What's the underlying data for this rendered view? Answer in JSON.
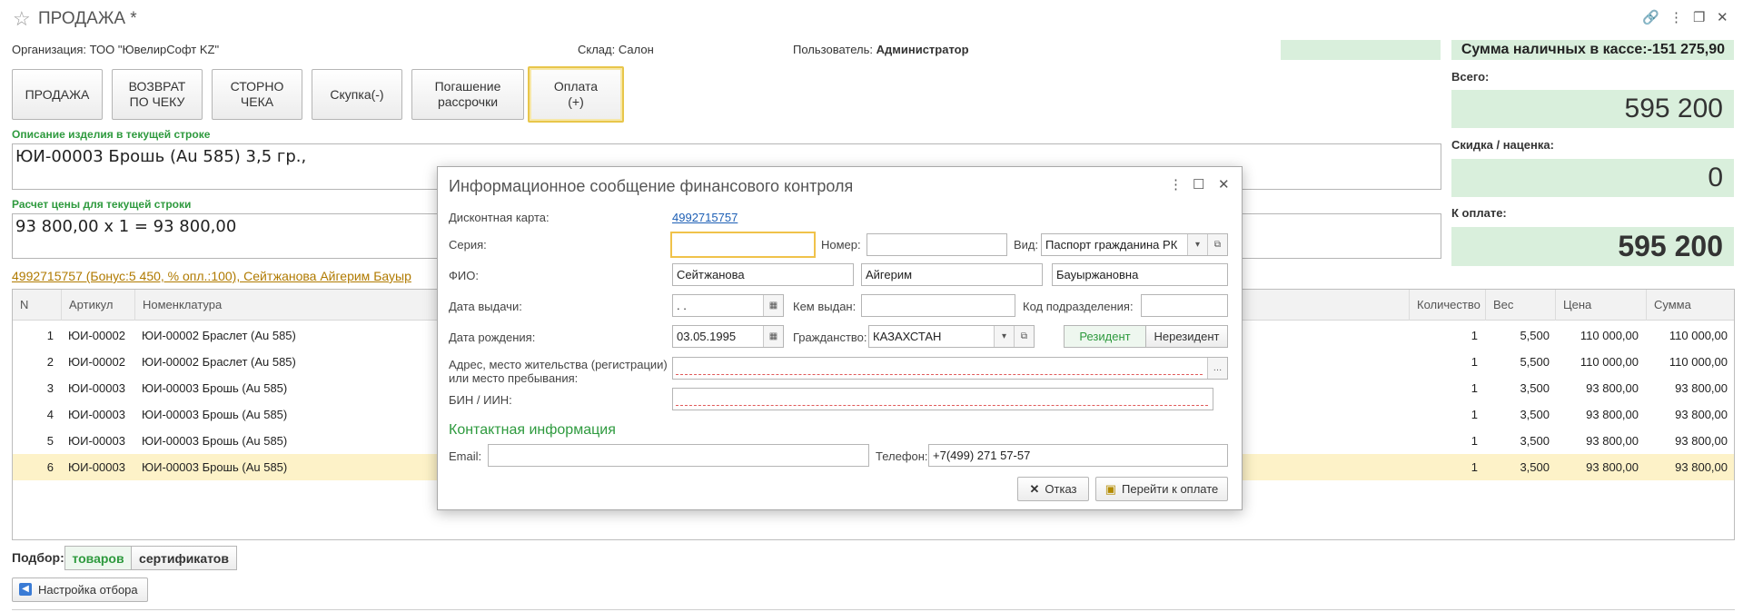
{
  "window": {
    "title": "ПРОДАЖА *"
  },
  "header": {
    "org_label": "Организация:",
    "org_value": "ТОО \"ЮвелирСофт KZ\"",
    "store_label": "Склад:",
    "store_value": "Салон",
    "user_label": "Пользователь:",
    "user_value": "Администратор",
    "cash": "Сумма наличных в кассе:-151 275,90"
  },
  "buttons": [
    {
      "label": "ПРОДАЖА"
    },
    {
      "label": "ВОЗВРАТ\nПО ЧЕКУ"
    },
    {
      "label": "СТОРНО\nЧЕКА"
    },
    {
      "label": "Скупка(-)"
    },
    {
      "label": "Погашение\nрассрочки"
    },
    {
      "label": "Оплата\n(+)"
    }
  ],
  "right_panel": {
    "total_label": "Всего:",
    "total_value": "595 200",
    "discount_label": "Скидка / наценка:",
    "discount_value": "0",
    "pay_label": "К оплате:",
    "pay_value": "595 200"
  },
  "description": {
    "label": "Описание изделия в текущей строке",
    "value": "ЮИ-00003 Брошь (Au 585) 3,5 гр.,"
  },
  "price_calc": {
    "label": "Расчет цены для текущей строки",
    "value": "93 800,00 x 1 = 93 800,00"
  },
  "card_link": "4992715757 (Бонус:5 450, % опл.:100), Сейтжанова Айгерим Бауыр",
  "table": {
    "headers": {
      "n": "N",
      "article": "Артикул",
      "nomen": "Номенклатура",
      "qty": "Количество",
      "weight": "Вес",
      "price": "Цена",
      "sum": "Сумма"
    },
    "rows": [
      {
        "n": "1",
        "article": "ЮИ-00002",
        "nomen": "ЮИ-00002 Браслет (Au 585)",
        "qty": "1",
        "weight": "5,500",
        "price": "110 000,00",
        "sum": "110 000,00"
      },
      {
        "n": "2",
        "article": "ЮИ-00002",
        "nomen": "ЮИ-00002 Браслет (Au 585)",
        "qty": "1",
        "weight": "5,500",
        "price": "110 000,00",
        "sum": "110 000,00"
      },
      {
        "n": "3",
        "article": "ЮИ-00003",
        "nomen": "ЮИ-00003 Брошь (Au 585)",
        "qty": "1",
        "weight": "3,500",
        "price": "93 800,00",
        "sum": "93 800,00"
      },
      {
        "n": "4",
        "article": "ЮИ-00003",
        "nomen": "ЮИ-00003 Брошь (Au 585)",
        "qty": "1",
        "weight": "3,500",
        "price": "93 800,00",
        "sum": "93 800,00"
      },
      {
        "n": "5",
        "article": "ЮИ-00003",
        "nomen": "ЮИ-00003 Брошь (Au 585)",
        "qty": "1",
        "weight": "3,500",
        "price": "93 800,00",
        "sum": "93 800,00"
      },
      {
        "n": "6",
        "article": "ЮИ-00003",
        "nomen": "ЮИ-00003 Брошь (Au 585)",
        "qty": "1",
        "weight": "3,500",
        "price": "93 800,00",
        "sum": "93 800,00"
      }
    ]
  },
  "bottom": {
    "podbor_label": "Подбор:",
    "goods": "товаров",
    "certs": "сертификатов",
    "filter_button": "Настройка отбора"
  },
  "modal": {
    "title": "Информационное сообщение финансового контроля",
    "card_label": "Дисконтная карта:",
    "card_value": "4992715757",
    "series_label": "Серия:",
    "series_value": "",
    "number_label": "Номер:",
    "number_value": "",
    "kind_label": "Вид:",
    "kind_value": "Паспорт гражданина РК",
    "fio_label": "ФИО:",
    "last_name": "Сейтжанова",
    "first_name": "Айгерим",
    "middle_name": "Бауыржановна",
    "issue_date_label": "Дата выдачи:",
    "issue_date_value": " .  .",
    "issued_by_label": "Кем выдан:",
    "issued_by_value": "",
    "dept_code_label": "Код подразделения:",
    "dept_code_value": "",
    "birth_label": "Дата рождения:",
    "birth_value": "03.05.1995",
    "citizenship_label": "Гражданство:",
    "citizenship_value": "КАЗАХСТАН",
    "resident": "Резидент",
    "nonresident": "Нерезидент",
    "address_label_1": "Адрес, место жительства (регистрации)",
    "address_label_2": "или место пребывания:",
    "address_value": "",
    "bin_label": "БИН / ИИН:",
    "bin_value": "",
    "contact_header": "Контактная информация",
    "email_label": "Email:",
    "email_value": "",
    "phone_label": "Телефон:",
    "phone_value": "+7(499) 271 57-57",
    "cancel_button": "Отказ",
    "pay_button": "Перейти к оплате"
  },
  "colors": {
    "accent_green": "#2e9a3e",
    "panel_green": "#d9efdc",
    "selection": "#fdf2c8",
    "link_blue": "#1d5fb5",
    "focus_yellow": "#f0c24a"
  }
}
